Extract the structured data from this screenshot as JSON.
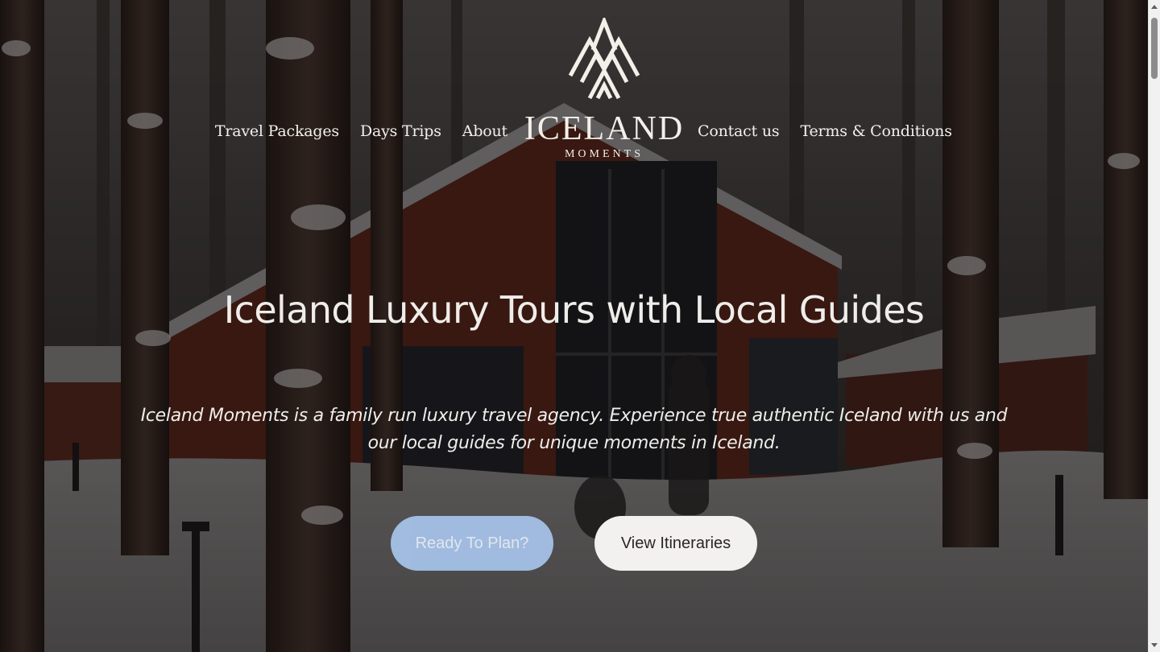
{
  "nav": {
    "left": [
      {
        "label": "Travel Packages"
      },
      {
        "label": "Days Trips"
      },
      {
        "label": "About"
      }
    ],
    "right": [
      {
        "label": "Contact us"
      },
      {
        "label": "Terms & Conditions"
      }
    ]
  },
  "logo": {
    "word": "ICELAND",
    "sub": "MOMENTS",
    "icon": "mountain-logo-icon"
  },
  "hero": {
    "title": "Iceland Luxury Tours with Local Guides",
    "text": "Iceland Moments is a family run luxury travel agency. Experience true authentic Iceland with us and our local guides for unique moments in Iceland."
  },
  "buttons": {
    "plan_label": "Ready To Plan?",
    "itineraries_label": "View Itineraries"
  },
  "colors": {
    "plan_button": "#a7c5ec",
    "itineraries_button": "#f3f1f0",
    "text_light": "#efedea"
  }
}
